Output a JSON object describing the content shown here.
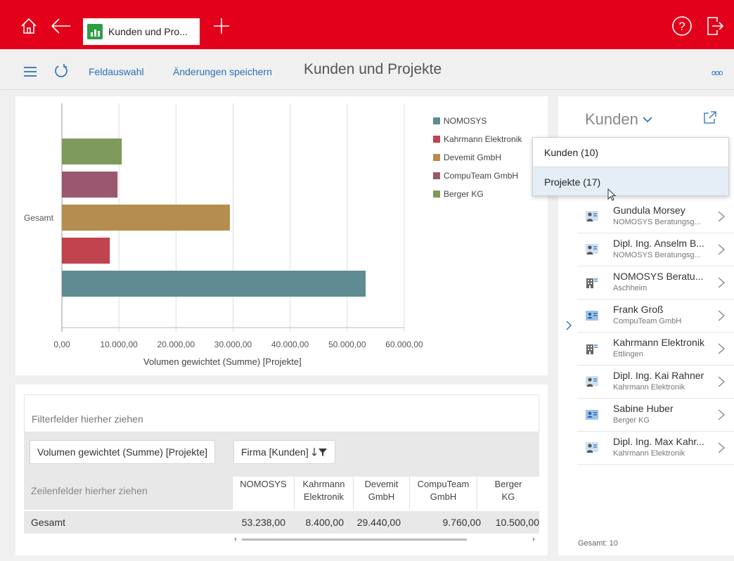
{
  "topbar": {
    "tab_label": "Kunden und Pro...",
    "icons": [
      "home-icon",
      "back-icon",
      "add-icon",
      "help-icon",
      "logout-icon"
    ]
  },
  "toolbar": {
    "feldauswahl": "Feldauswahl",
    "save": "Änderungen speichern",
    "title": "Kunden und Projekte",
    "more": "ooo"
  },
  "chart_data": {
    "type": "bar",
    "orientation": "horizontal",
    "categories": [
      "Gesamt"
    ],
    "series": [
      {
        "name": "NOMOSYS",
        "values": [
          53238.0
        ],
        "color": "#5f8b93"
      },
      {
        "name": "Kahrmann Elektronik",
        "values": [
          8400.0
        ],
        "color": "#c1434e"
      },
      {
        "name": "Devemit GmbH",
        "values": [
          29440.0
        ],
        "color": "#b58d4e"
      },
      {
        "name": "CompuTeam GmbH",
        "values": [
          9760.0
        ],
        "color": "#9a5870"
      },
      {
        "name": "Berger KG",
        "values": [
          10500.0
        ],
        "color": "#7f9a5d"
      }
    ],
    "xlabel": "Volumen gewichtet (Summe) [Projekte]",
    "ylabel": "",
    "xlim": [
      0,
      60000
    ],
    "xticks": [
      "0,00",
      "10.000,00",
      "20.000,00",
      "30.000,00",
      "40.000,00",
      "50.000,00",
      "60.000,00"
    ],
    "grid": true,
    "legend": "top-right"
  },
  "pivot": {
    "filter_zone": "Filterfelder hierher ziehen",
    "value_field": "Volumen gewichtet (Summe) [Projekte]",
    "column_field": "Firma [Kunden]",
    "row_zone": "Zeilenfelder hierher ziehen",
    "columns": [
      {
        "l1": "NOMOSYS",
        "l2": ""
      },
      {
        "l1": "Kahrmann",
        "l2": "Elektronik"
      },
      {
        "l1": "Devemit",
        "l2": "GmbH"
      },
      {
        "l1": "CompuTeam",
        "l2": "GmbH"
      },
      {
        "l1": "Berger",
        "l2": "KG"
      }
    ],
    "row_label": "Gesamt",
    "values": [
      "53.238,00",
      "8.400,00",
      "29.440,00",
      "9.760,00",
      "10.500,00"
    ]
  },
  "right": {
    "title": "Kunden",
    "dropdown": [
      "Kunden (10)",
      "Projekte (17)"
    ],
    "items": [
      {
        "name": "Gundula Morsey",
        "sub": "NOMOSYS Beratungsg...",
        "icon": "contact-person-icon"
      },
      {
        "name": "Dipl. Ing. Anselm B...",
        "sub": "NOMOSYS Beratungsg...",
        "icon": "contact-person-icon"
      },
      {
        "name": "NOMOSYS Beratu...",
        "sub": "Aschheim",
        "icon": "company-building-icon"
      },
      {
        "name": "Frank Groß",
        "sub": "CompuTeam GmbH",
        "icon": "contact-card-icon"
      },
      {
        "name": "Kahrmann Elektronik",
        "sub": "Ettlingen",
        "icon": "company-building-icon"
      },
      {
        "name": "Dipl. Ing. Kai Rahner",
        "sub": "Kahrmann Elektronik",
        "icon": "contact-person-icon"
      },
      {
        "name": "Sabine Huber",
        "sub": "Berger KG",
        "icon": "contact-card-icon"
      },
      {
        "name": "Dipl. Ing. Max Kahr...",
        "sub": "Kahrmann Elektronik",
        "icon": "contact-person-icon"
      }
    ],
    "total": "Gesamt: 10"
  }
}
